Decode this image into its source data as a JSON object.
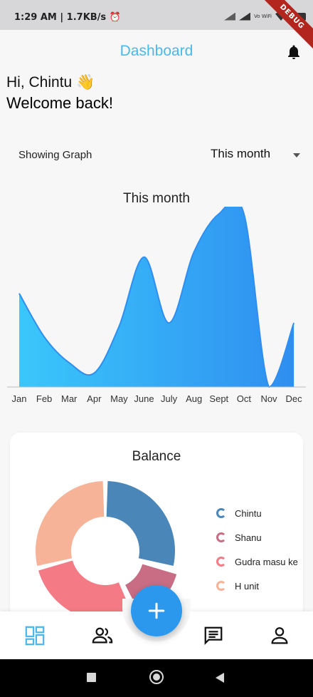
{
  "status_bar": {
    "time": "1:29 AM | 1.7KB/s ⏰",
    "volte_label": "Vo WiFi",
    "debug_banner": "DEBUG"
  },
  "appbar": {
    "title": "Dashboard",
    "bell_icon": "notifications-icon"
  },
  "greeting": {
    "line1": "Hi, Chintu 👋",
    "line2": "Welcome back!"
  },
  "graph_filter": {
    "label": "Showing Graph",
    "selected": "This month"
  },
  "colors": {
    "accent": "#4cb8e8",
    "fab": "#2b98ee",
    "area_gradient_start": "#3ac7fb",
    "area_gradient_end": "#2f8ef0"
  },
  "chart_data": [
    {
      "type": "area",
      "title": "This month",
      "categories": [
        "Jan",
        "Feb",
        "Mar",
        "Apr",
        "May",
        "June",
        "July",
        "Aug",
        "Sept",
        "Oct",
        "Nov",
        "Dec"
      ],
      "values": [
        54,
        29,
        14,
        8,
        35,
        75,
        37,
        78,
        100,
        100,
        0,
        37
      ],
      "ylim": [
        0,
        100
      ],
      "grid": false,
      "legend": "none"
    },
    {
      "type": "pie",
      "title": "Balance",
      "donut": true,
      "categories": [
        "Chintu",
        "Shanu",
        "Gudra masu ke",
        "H unit"
      ],
      "values": [
        29,
        14,
        28,
        29
      ],
      "colors": [
        "#4b86b8",
        "#c86d84",
        "#f47b86",
        "#f6b398"
      ],
      "legend": "right"
    }
  ],
  "bottom_nav": {
    "items": [
      "dashboard-icon",
      "people-icon",
      "chat-icon",
      "person-icon"
    ],
    "fab_icon": "plus-icon"
  }
}
